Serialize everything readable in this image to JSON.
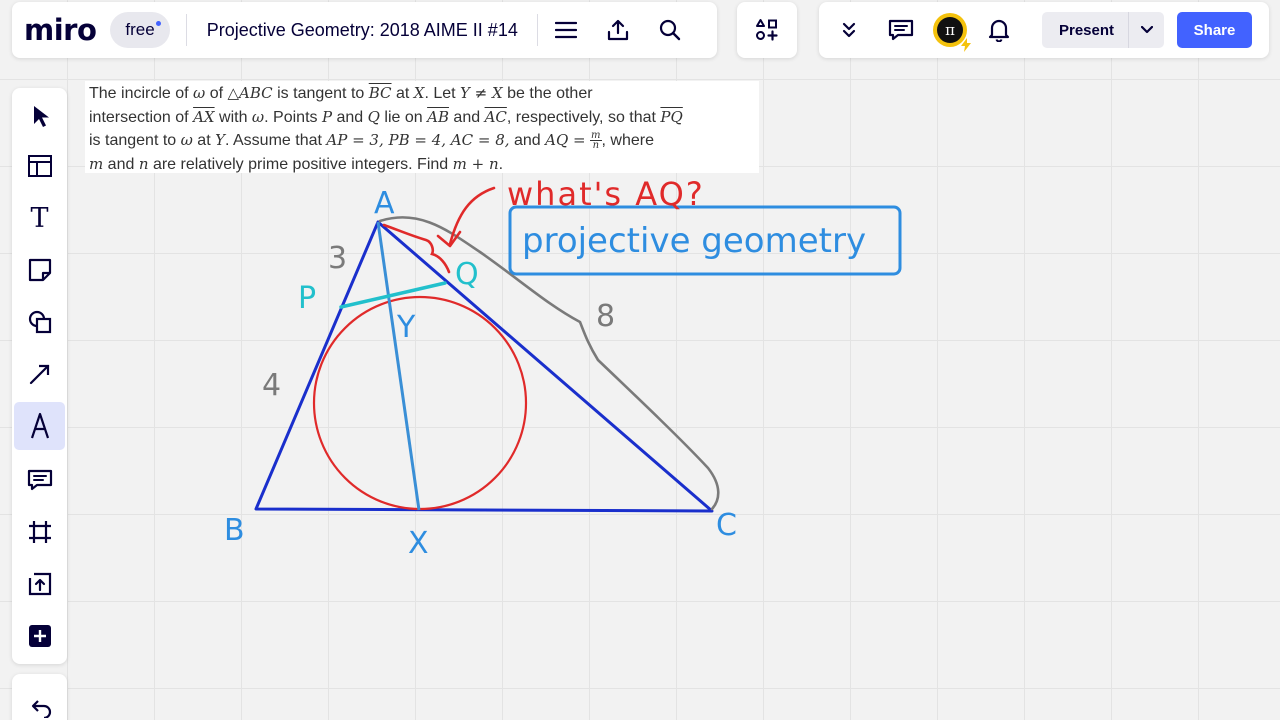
{
  "topbar": {
    "logo": "miro",
    "plan_badge": "free",
    "board_title": "Projective Geometry: 2018 AIME II #14",
    "menu_icon": "hamburger-menu-icon",
    "export_icon": "upload-icon",
    "search_icon": "search-icon"
  },
  "apps_icon": "apps-grid-plus-icon",
  "collab": {
    "expand_icon": "double-chevron-down-icon",
    "comments_icon": "comment-icon",
    "avatar_glyph": "π",
    "notifications_icon": "bell-icon",
    "present_label": "Present",
    "share_label": "Share"
  },
  "toolbar": [
    {
      "name": "select-tool",
      "icon": "cursor-arrow-icon"
    },
    {
      "name": "templates-tool",
      "icon": "layout-template-icon"
    },
    {
      "name": "text-tool",
      "icon": "text-T-icon",
      "glyph": "T"
    },
    {
      "name": "sticky-note-tool",
      "icon": "sticky-note-icon"
    },
    {
      "name": "shapes-tool",
      "icon": "shapes-icon"
    },
    {
      "name": "connector-tool",
      "icon": "arrow-line-icon"
    },
    {
      "name": "pen-tool",
      "icon": "pen-icon",
      "active": true
    },
    {
      "name": "comment-tool",
      "icon": "comment-icon"
    },
    {
      "name": "frame-tool",
      "icon": "frame-icon"
    },
    {
      "name": "upload-tool",
      "icon": "upload-icon"
    },
    {
      "name": "more-apps-tool",
      "icon": "plus-icon"
    }
  ],
  "undo_icon": "undo-icon",
  "problem": {
    "l1": {
      "a": "The incircle of ",
      "b": "ω",
      "c": " of ",
      "d": "△ABC",
      "e": " is tangent to ",
      "f": "BC",
      "g": " at ",
      "h": "X",
      "i": ". Let ",
      "j": "Y ≠ X",
      "k": " be the other"
    },
    "l2": {
      "a": "intersection of ",
      "b": "AX",
      "c": " with ",
      "d": "ω",
      "e": ". Points ",
      "f": "P",
      "g": " and ",
      "h": "Q",
      "i": " lie on ",
      "j": "AB",
      "k": " and ",
      "l": "AC",
      "m": ", respectively, so that ",
      "n": "PQ"
    },
    "l3": {
      "a": "is tangent to ",
      "b": "ω",
      "c": " at ",
      "d": "Y",
      "e": ". Assume that ",
      "f": "AP = 3, PB = 4, AC = 8,",
      "g": " and ",
      "h": "AQ =",
      "num": "m",
      "den": "n",
      "i": ", where"
    },
    "l4": {
      "a": "m",
      "b": " and ",
      "c": "n",
      "d": " are relatively prime positive integers. Find ",
      "e": "m + n",
      "f": "."
    }
  },
  "annotations": {
    "A": "A",
    "B": "B",
    "C": "C",
    "X": "X",
    "Y": "Y",
    "P": "P",
    "Q": "Q",
    "seg_AP": "3",
    "seg_PB": "4",
    "seg_AC": "8",
    "question": "what's AQ?",
    "boxed": "projective geometry"
  },
  "colors": {
    "accent": "#4262ff",
    "triangle": "#1a2fcc",
    "incircle": "#e02a2a",
    "cevian": "#3a8fd6",
    "tangent_pq": "#22c0cc",
    "labels_blue": "#2e8de0",
    "measure_gray": "#7a7a7a",
    "question_red": "#e02a2a"
  }
}
